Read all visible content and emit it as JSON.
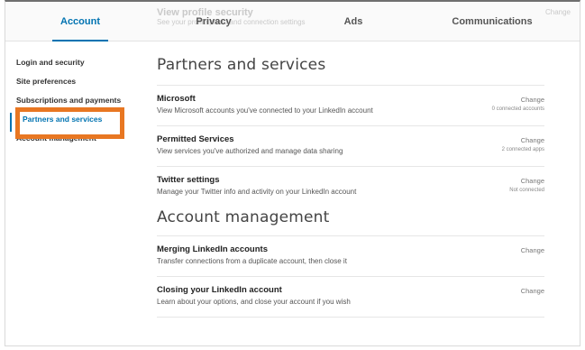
{
  "topnav": {
    "ghost_title": "View profile security",
    "ghost_desc": "See your profile photo and connection settings",
    "ghost_right": "Change",
    "tabs": [
      {
        "label": "Account"
      },
      {
        "label": "Privacy"
      },
      {
        "label": "Ads"
      },
      {
        "label": "Communications"
      }
    ]
  },
  "sidebar": {
    "items": [
      {
        "label": "Login and security"
      },
      {
        "label": "Site preferences"
      },
      {
        "label": "Subscriptions and payments"
      },
      {
        "label": "Partners and services"
      },
      {
        "label": "Account management"
      }
    ],
    "active_color": "#0073b1",
    "highlight_color": "#e87722"
  },
  "sections": [
    {
      "title": "Partners and services",
      "rows": [
        {
          "title": "Microsoft",
          "desc": "View Microsoft accounts you've connected to your LinkedIn account",
          "action": "Change",
          "status": "0 connected accounts"
        },
        {
          "title": "Permitted Services",
          "desc": "View services you've authorized and manage data sharing",
          "action": "Change",
          "status": "2 connected apps"
        },
        {
          "title": "Twitter settings",
          "desc": "Manage your Twitter info and activity on your LinkedIn account",
          "action": "Change",
          "status": "Not connected"
        }
      ]
    },
    {
      "title": "Account management",
      "rows": [
        {
          "title": "Merging LinkedIn accounts",
          "desc": "Transfer connections from a duplicate account, then close it",
          "action": "Change",
          "status": ""
        },
        {
          "title": "Closing your LinkedIn account",
          "desc": "Learn about your options, and close your account if you wish",
          "action": "Change",
          "status": ""
        }
      ]
    }
  ]
}
